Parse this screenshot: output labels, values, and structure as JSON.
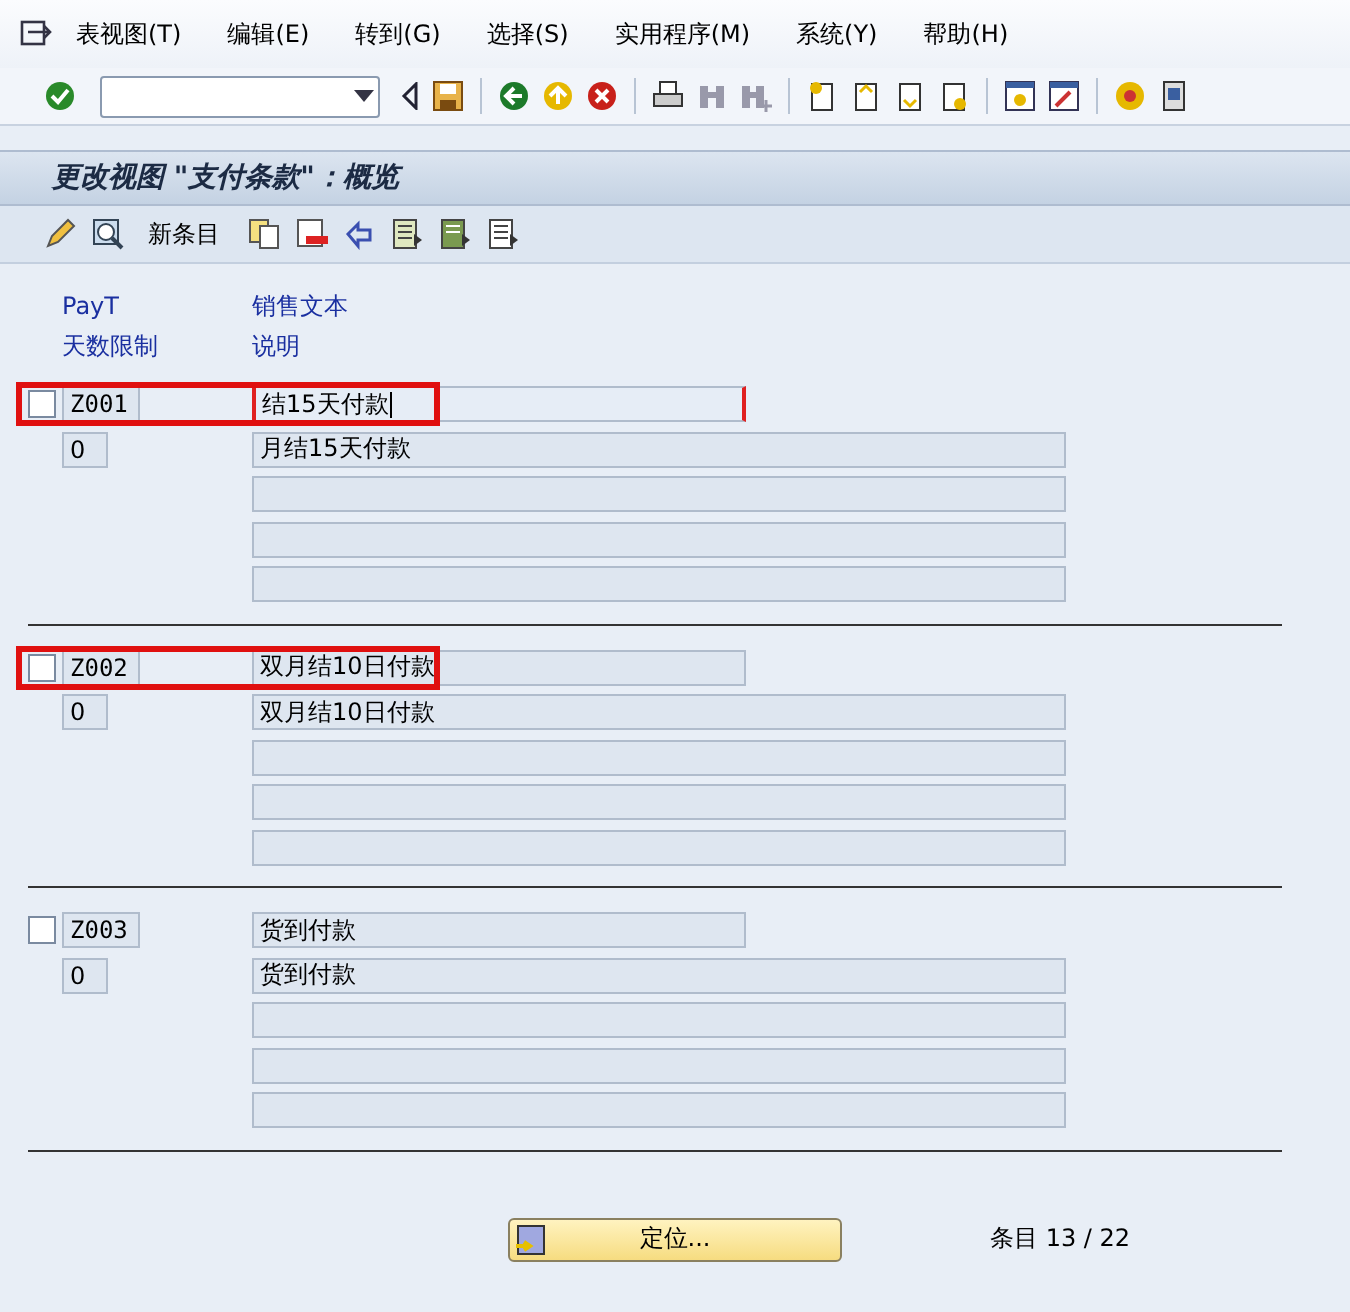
{
  "menu": [
    {
      "label": "表视图(T)"
    },
    {
      "label": "编辑(E)"
    },
    {
      "label": "转到(G)"
    },
    {
      "label": "选择(S)"
    },
    {
      "label": "实用程序(M)"
    },
    {
      "label": "系统(Y)"
    },
    {
      "label": "帮助(H)"
    }
  ],
  "title": "更改视图 \"支付条款\"：概览",
  "app_toolbar": {
    "new_entries": "新条目"
  },
  "columns": [
    {
      "top": "PayT",
      "bottom": "天数限制"
    },
    {
      "top": "销售文本",
      "bottom": "说明"
    }
  ],
  "records": [
    {
      "selected": false,
      "highlighted": true,
      "focused": true,
      "code": "Z001",
      "sales_text": "结15天付款",
      "days": "0",
      "description": "月结15天付款"
    },
    {
      "selected": false,
      "highlighted": true,
      "focused": false,
      "code": "Z002",
      "sales_text": "双月结10日付款",
      "days": "0",
      "description": "双月结10日付款"
    },
    {
      "selected": false,
      "highlighted": false,
      "focused": false,
      "code": "Z003",
      "sales_text": "货到付款",
      "days": "0",
      "description": "货到付款"
    }
  ],
  "position_button": "定位...",
  "entry_count": "条目 13 / 22"
}
